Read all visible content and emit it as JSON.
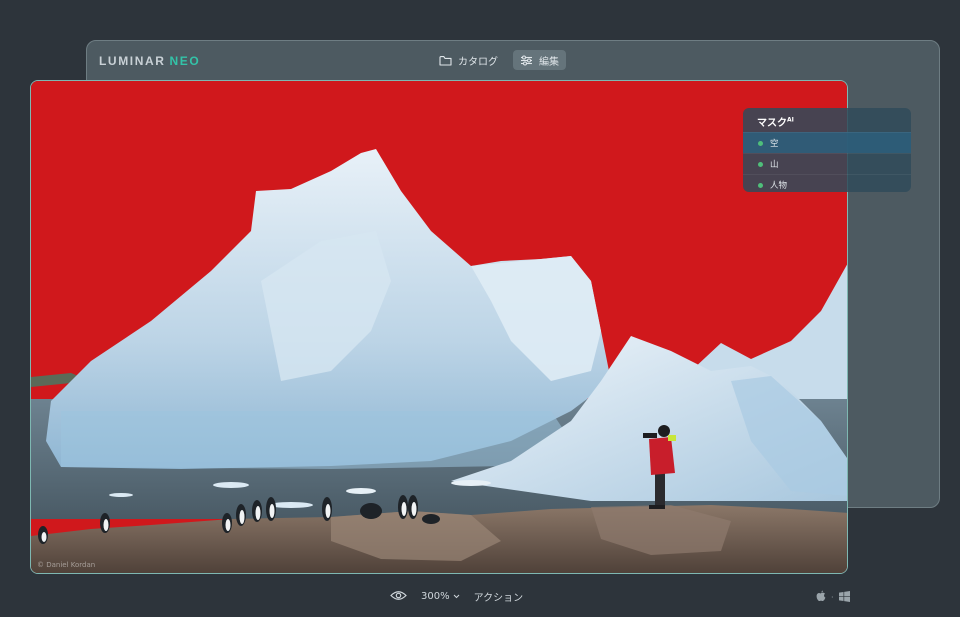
{
  "app": {
    "logo_main": "LUMINAR",
    "logo_accent": "NEO"
  },
  "tabs": [
    {
      "label": "カタログ",
      "icon": "folder-icon",
      "active": false
    },
    {
      "label": "編集",
      "icon": "sliders-icon",
      "active": true
    }
  ],
  "mask_panel": {
    "title": "マスク",
    "title_sup": "AI",
    "items": [
      {
        "label": "空",
        "selected": true
      },
      {
        "label": "山",
        "selected": false
      },
      {
        "label": "人物",
        "selected": false
      }
    ]
  },
  "photo": {
    "credit": "© Daniel Kordan",
    "overlay_color": "#d0181c"
  },
  "bottom_bar": {
    "zoom": "300%",
    "actions": "アクション"
  },
  "platforms": {
    "separator": "·"
  }
}
